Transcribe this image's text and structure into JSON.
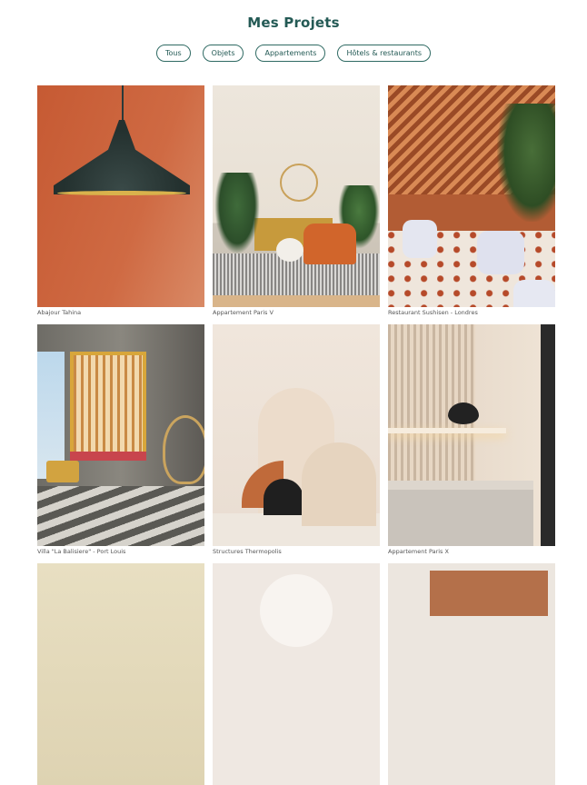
{
  "page": {
    "title": "Mes Projets"
  },
  "filters": [
    {
      "label": "Tous"
    },
    {
      "label": "Objets"
    },
    {
      "label": "Appartements"
    },
    {
      "label": "Hôtels & restaurants"
    }
  ],
  "projects": [
    {
      "caption": "Abajour Tahina"
    },
    {
      "caption": "Appartement Paris V"
    },
    {
      "caption": "Restaurant Sushisen - Londres"
    },
    {
      "caption": "Villa \"La Balisiere\" - Port Louis"
    },
    {
      "caption": "Structures Thermopolis"
    },
    {
      "caption": "Appartement Paris X"
    }
  ],
  "colors": {
    "accent": "#245a55",
    "border": "#2f6a63"
  }
}
